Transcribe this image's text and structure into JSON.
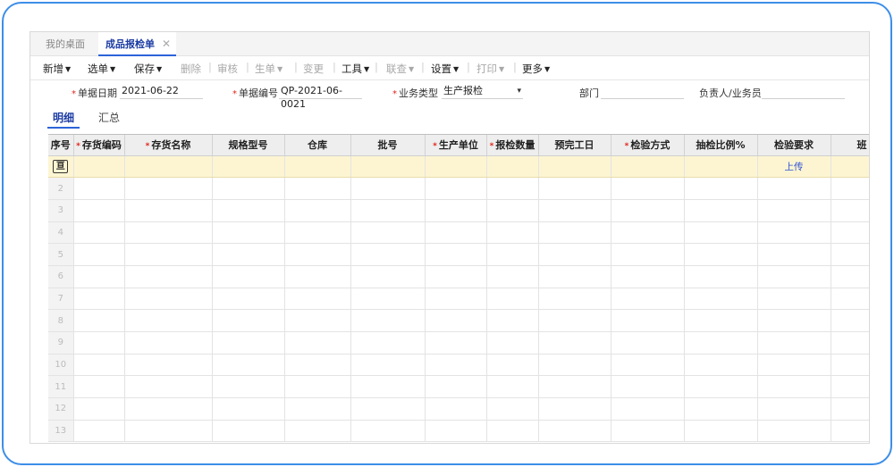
{
  "tabs": {
    "home": "我的桌面",
    "active": "成品报检单",
    "close": "✕"
  },
  "toolbar": [
    {
      "label": "新增",
      "dropdown": true,
      "disabled": false
    },
    {
      "label": "选单",
      "dropdown": true,
      "disabled": false
    },
    {
      "label": "保存",
      "dropdown": true,
      "disabled": false
    },
    {
      "label": "删除",
      "dropdown": false,
      "disabled": true
    },
    {
      "label": "审核",
      "dropdown": false,
      "disabled": true
    },
    {
      "label": "生单",
      "dropdown": true,
      "disabled": true
    },
    {
      "label": "变更",
      "dropdown": false,
      "disabled": true
    },
    {
      "label": "工具",
      "dropdown": true,
      "disabled": false
    },
    {
      "label": "联查",
      "dropdown": true,
      "disabled": true
    },
    {
      "label": "设置",
      "dropdown": true,
      "disabled": false
    },
    {
      "label": "打印",
      "dropdown": true,
      "disabled": true
    },
    {
      "label": "更多",
      "dropdown": true,
      "disabled": false
    }
  ],
  "form": {
    "date_label": "单据日期",
    "date_value": "2021-06-22",
    "code_label": "单据编号",
    "code_value": "QP-2021-06-0021",
    "biz_label": "业务类型",
    "biz_value": "生产报检",
    "dept_label": "部门",
    "dept_value": "",
    "person_label": "负责人/业务员",
    "person_value": ""
  },
  "subtabs": {
    "detail": "明细",
    "summary": "汇总"
  },
  "grid": {
    "columns": [
      {
        "label": "序号",
        "required": false
      },
      {
        "label": "存货编码",
        "required": true
      },
      {
        "label": "存货名称",
        "required": true
      },
      {
        "label": "规格型号",
        "required": false
      },
      {
        "label": "仓库",
        "required": false
      },
      {
        "label": "批号",
        "required": false
      },
      {
        "label": "生产单位",
        "required": true
      },
      {
        "label": "报检数量",
        "required": true
      },
      {
        "label": "预完工日",
        "required": false
      },
      {
        "label": "检验方式",
        "required": true
      },
      {
        "label": "抽检比例%",
        "required": false
      },
      {
        "label": "检验要求",
        "required": false
      },
      {
        "label": "班",
        "required": false
      }
    ],
    "first_row_icon": "亘",
    "upload_label": "上传",
    "row_numbers": [
      "2",
      "3",
      "4",
      "5",
      "6",
      "7",
      "8",
      "9",
      "10",
      "11",
      "12",
      "13"
    ]
  },
  "colors": {
    "accent": "#2b63d9",
    "frame": "#3d8ee8",
    "required": "#e2231a",
    "highlight_row": "#fdf5d2"
  }
}
